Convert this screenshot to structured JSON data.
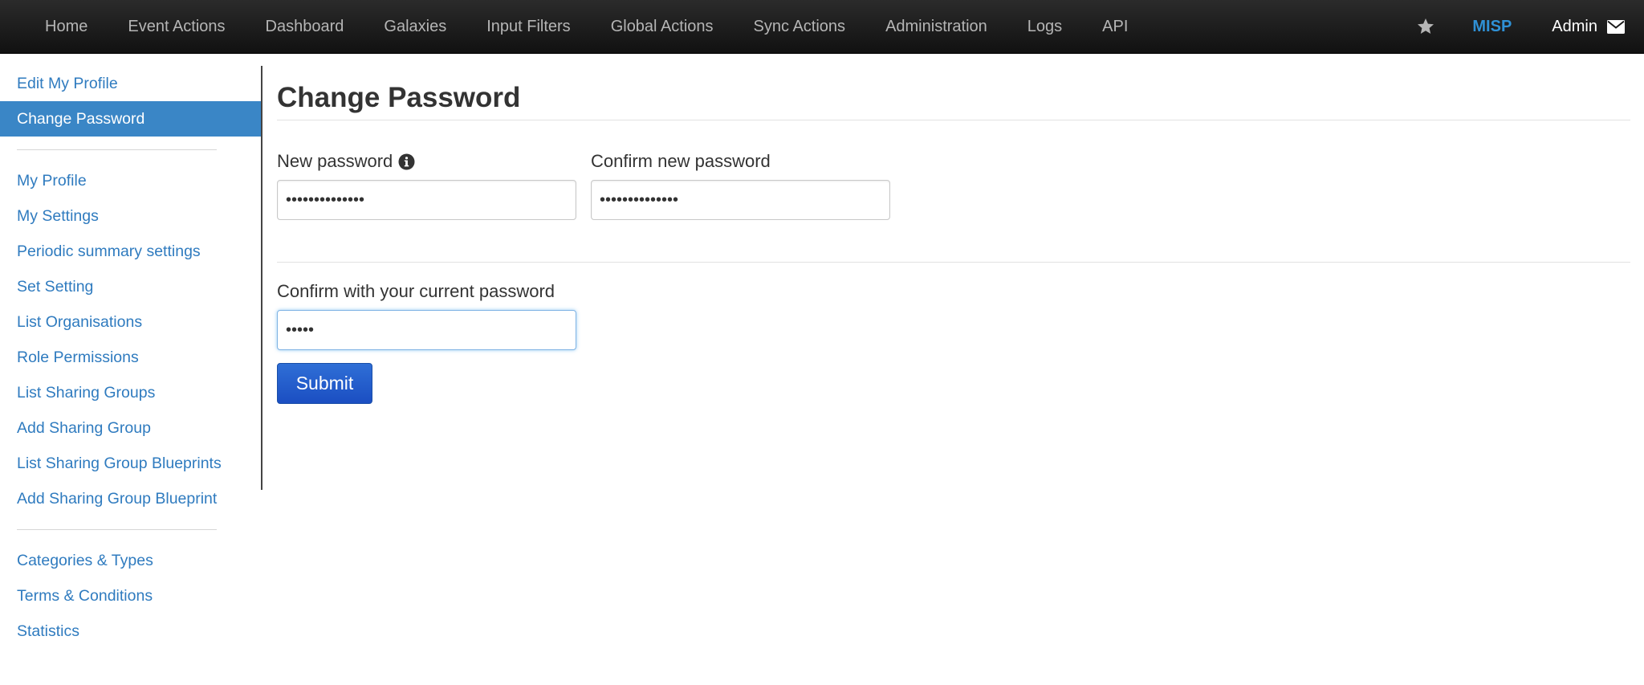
{
  "navbar": {
    "items": [
      {
        "label": "Home"
      },
      {
        "label": "Event Actions"
      },
      {
        "label": "Dashboard"
      },
      {
        "label": "Galaxies"
      },
      {
        "label": "Input Filters"
      },
      {
        "label": "Global Actions"
      },
      {
        "label": "Sync Actions"
      },
      {
        "label": "Administration"
      },
      {
        "label": "Logs"
      },
      {
        "label": "API"
      }
    ],
    "brand": "MISP",
    "user": "Admin",
    "icons": {
      "favorite": "star-icon",
      "messages": "envelope-icon"
    }
  },
  "sidebar": {
    "group1": [
      {
        "label": "Edit My Profile",
        "active": false
      },
      {
        "label": "Change Password",
        "active": true
      }
    ],
    "group2": [
      {
        "label": "My Profile"
      },
      {
        "label": "My Settings"
      },
      {
        "label": "Periodic summary settings"
      },
      {
        "label": "Set Setting"
      },
      {
        "label": "List Organisations"
      },
      {
        "label": "Role Permissions"
      },
      {
        "label": "List Sharing Groups"
      },
      {
        "label": "Add Sharing Group"
      },
      {
        "label": "List Sharing Group Blueprints"
      },
      {
        "label": "Add Sharing Group Blueprint"
      }
    ],
    "group3": [
      {
        "label": "Categories & Types"
      },
      {
        "label": "Terms & Conditions"
      },
      {
        "label": "Statistics"
      }
    ]
  },
  "main": {
    "title": "Change Password",
    "new_password": {
      "label": "New password",
      "value": "••••••••••••••"
    },
    "confirm_new_password": {
      "label": "Confirm new password",
      "value": "••••••••••••••"
    },
    "current_password": {
      "label": "Confirm with your current password",
      "value": "•••••"
    },
    "submit_label": "Submit"
  },
  "colors": {
    "accent": "#2f91d6",
    "link": "#2f7bbf",
    "active_bg": "#3a86c6",
    "submit_bg": "#1b4ec2"
  }
}
